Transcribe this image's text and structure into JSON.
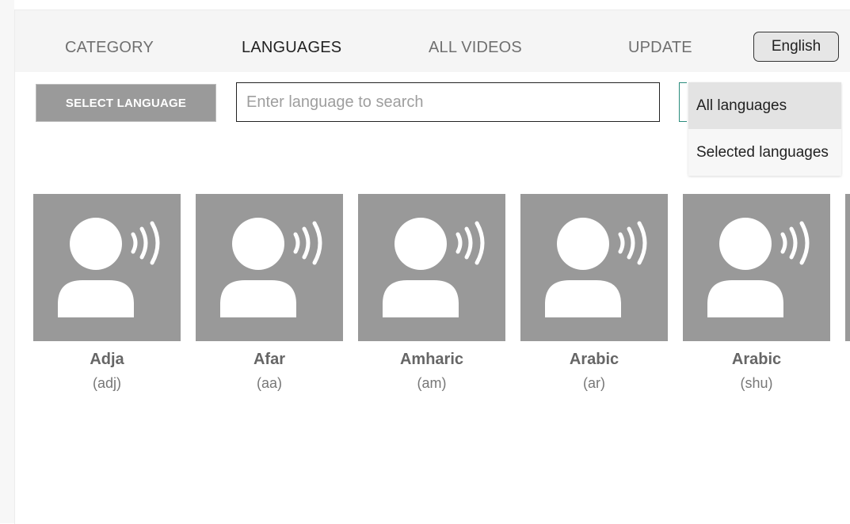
{
  "nav": {
    "tabs": [
      {
        "label": "CATEGORY"
      },
      {
        "label": "LANGUAGES"
      },
      {
        "label": "ALL VIDEOS"
      },
      {
        "label": "UPDATE"
      }
    ],
    "active_tab": "LANGUAGES",
    "language_button": "English"
  },
  "toolbar": {
    "select_language_label": "SELECT LANGUAGE",
    "search_placeholder": "Enter language to search",
    "search_value": "",
    "filter_dropdown": {
      "options": [
        {
          "label": "All languages"
        },
        {
          "label": "Selected languages"
        }
      ],
      "selected": "All languages"
    }
  },
  "languages": [
    {
      "name": "Adja",
      "code": "(adj)"
    },
    {
      "name": "Afar",
      "code": "(aa)"
    },
    {
      "name": "Amharic",
      "code": "(am)"
    },
    {
      "name": "Arabic",
      "code": "(ar)"
    },
    {
      "name": "Arabic",
      "code": "(shu)"
    }
  ],
  "icons": {
    "card_icon": "speaking-person-icon"
  },
  "colors": {
    "card_background": "#999999",
    "icon_fill": "#ffffff",
    "filter_accent": "#2a8c7c"
  }
}
